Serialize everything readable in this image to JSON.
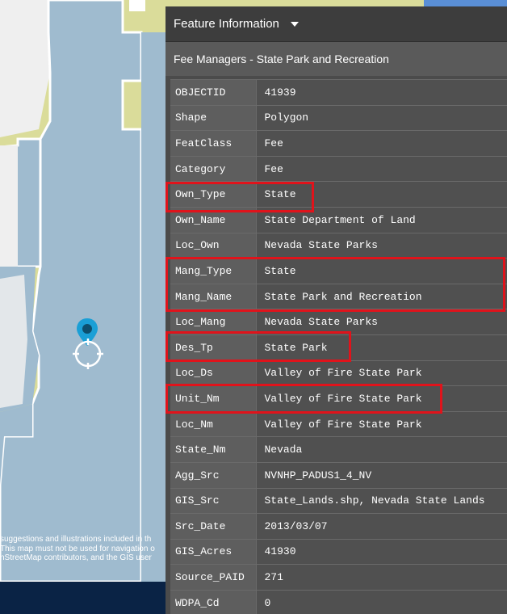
{
  "map": {
    "attribution_lines": [
      "suggestions and illustrations included in th",
      "This map must not be used for navigation o",
      "nStreetMap contributors, and the GIS user"
    ]
  },
  "panel": {
    "title": "Feature Information",
    "subtitle": "Fee Managers - State Park and Recreation",
    "rows": [
      {
        "key": "OBJECTID",
        "value": "41939"
      },
      {
        "key": "Shape",
        "value": "Polygon"
      },
      {
        "key": "FeatClass",
        "value": "Fee"
      },
      {
        "key": "Category",
        "value": "Fee"
      },
      {
        "key": "Own_Type",
        "value": "State"
      },
      {
        "key": "Own_Name",
        "value": "State Department of Land"
      },
      {
        "key": "Loc_Own",
        "value": "Nevada State Parks"
      },
      {
        "key": "Mang_Type",
        "value": "State"
      },
      {
        "key": "Mang_Name",
        "value": "State Park and Recreation"
      },
      {
        "key": "Loc_Mang",
        "value": "Nevada State Parks"
      },
      {
        "key": "Des_Tp",
        "value": "State Park"
      },
      {
        "key": "Loc_Ds",
        "value": "Valley of Fire State Park"
      },
      {
        "key": "Unit_Nm",
        "value": "Valley of Fire State Park"
      },
      {
        "key": "Loc_Nm",
        "value": "Valley of Fire State Park"
      },
      {
        "key": "State_Nm",
        "value": "Nevada"
      },
      {
        "key": "Agg_Src",
        "value": "NVNHP_PADUS1_4_NV"
      },
      {
        "key": "GIS_Src",
        "value": "State_Lands.shp, Nevada State Lands"
      },
      {
        "key": "Src_Date",
        "value": "2013/03/07"
      },
      {
        "key": "GIS_Acres",
        "value": "41930"
      },
      {
        "key": "Source_PAID",
        "value": "271"
      },
      {
        "key": "WDPA_Cd",
        "value": "0"
      }
    ]
  },
  "colors": {
    "highlight": "#e0131b",
    "map_land": "#dadc9a",
    "map_water": "#9fbbcf",
    "marker": "#1a9fd6"
  }
}
